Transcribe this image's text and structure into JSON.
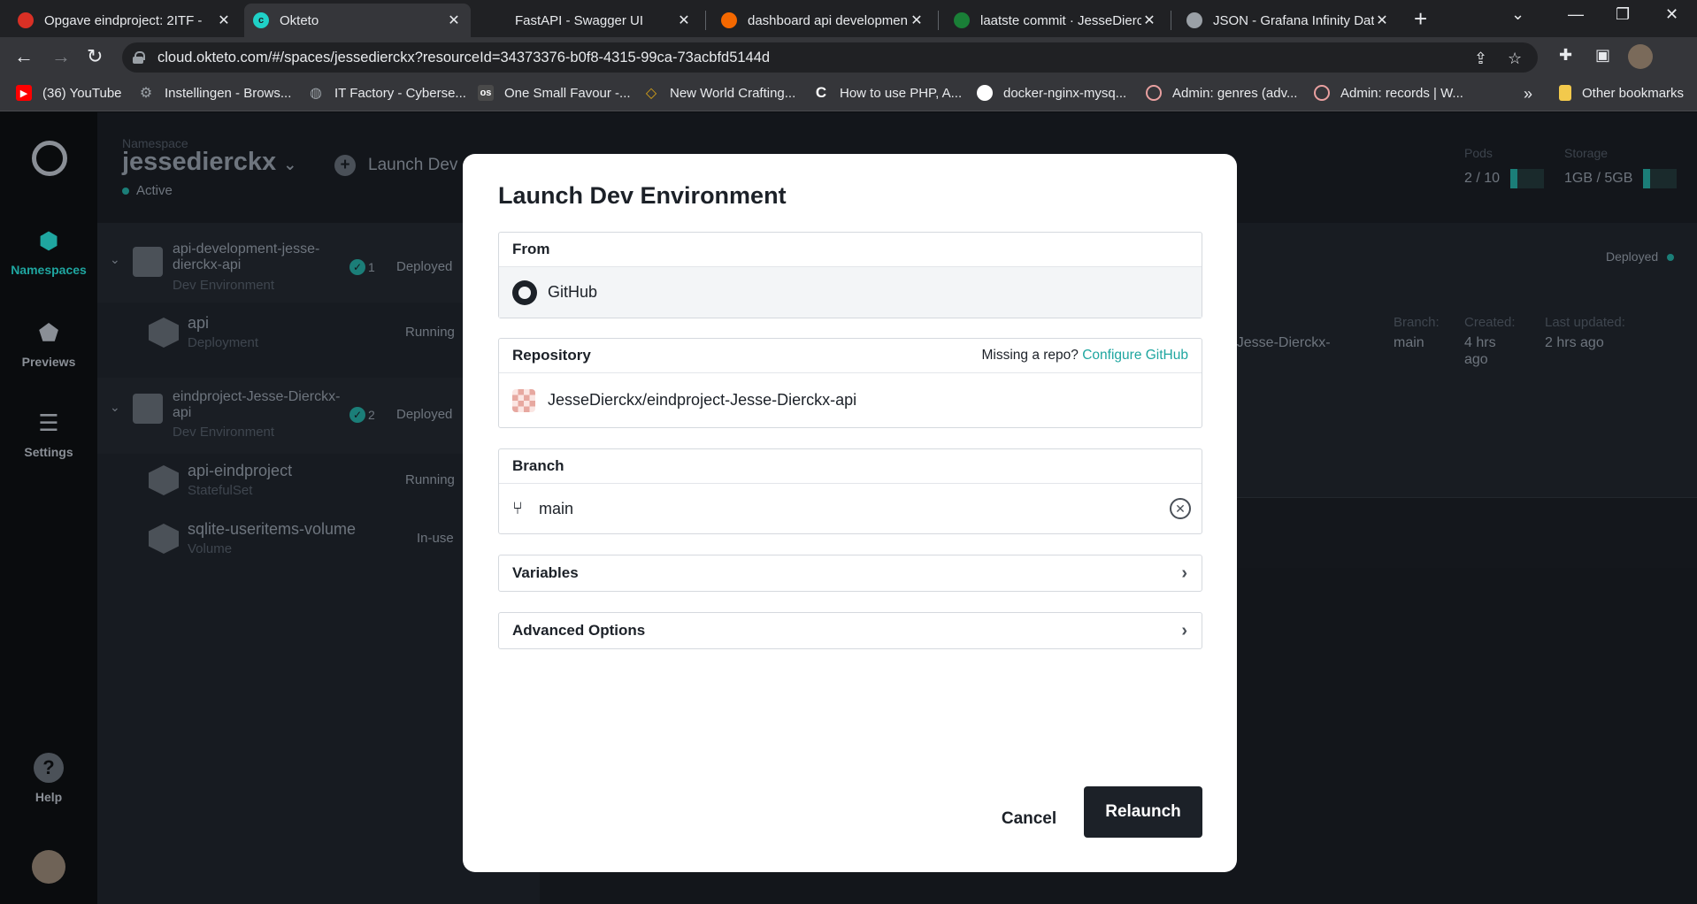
{
  "browser": {
    "tabs": [
      {
        "title": "Opgave eindproject: 2ITF - ",
        "favicon_color": "#d93025",
        "active": false
      },
      {
        "title": "Okteto",
        "favicon_color": "#1fd1c7",
        "active": true
      },
      {
        "title": "FastAPI - Swagger UI",
        "favicon_color": "#202124",
        "active": false
      },
      {
        "title": "dashboard api developmen",
        "favicon_color": "#f46800",
        "active": false
      },
      {
        "title": "laatste commit · JesseDierck",
        "favicon_color": "#1a7f37",
        "active": false
      },
      {
        "title": "JSON - Grafana Infinity Data",
        "favicon_color": "#9aa0a6",
        "active": false
      }
    ],
    "url": "cloud.okteto.com/#/spaces/jessedierckx?resourceId=34373376-b0f8-4315-99ca-73acbfd5144d",
    "bookmarks": [
      {
        "label": "(36) YouTube",
        "color": "#ff0000"
      },
      {
        "label": "Instellingen - Brows...",
        "color": "#9aa0a6"
      },
      {
        "label": "IT Factory - Cyberse...",
        "color": "#9aa0a6"
      },
      {
        "label": "One Small Favour -...",
        "color": "#bbbbbb"
      },
      {
        "label": "New World Crafting...",
        "color": "#d4a017"
      },
      {
        "label": "How to use PHP, A...",
        "color": "#ffffff"
      },
      {
        "label": "docker-nginx-mysq...",
        "color": "#ffffff"
      },
      {
        "label": "Admin: genres (adv...",
        "color": "#e8a0a0"
      },
      {
        "label": "Admin: records | W...",
        "color": "#e8a0a0"
      }
    ],
    "more_bookmarks": "»",
    "other_bookmarks": "Other bookmarks"
  },
  "app": {
    "rail": [
      {
        "label": "Namespaces",
        "icon": "namespaces-icon",
        "active": true
      },
      {
        "label": "Previews",
        "icon": "previews-icon",
        "active": false
      },
      {
        "label": "Settings",
        "icon": "settings-icon",
        "active": false
      },
      {
        "label": "Help",
        "icon": "help-icon",
        "active": false
      }
    ],
    "namespace_label": "Namespace",
    "namespace_name": "jessedierckx",
    "namespace_status": "Active",
    "launch_label": "Launch Dev",
    "pods_label": "Pods",
    "pods_value": "2 / 10",
    "pods_fraction": 0.2,
    "storage_label": "Storage",
    "storage_value": "1GB / 5GB",
    "storage_fraction": 0.2,
    "environments": [
      {
        "name": "api-development-jesse-dierckx-api",
        "type": "Dev Environment",
        "count": "1",
        "status": "Deployed",
        "services": [
          {
            "name": "api",
            "kind": "Deployment",
            "status": "Running"
          }
        ]
      },
      {
        "name": "eindproject-Jesse-Dierckx-api",
        "type": "Dev Environment",
        "count": "2",
        "status": "Deployed",
        "services": [
          {
            "name": "api-eindproject",
            "kind": "StatefulSet",
            "status": "Running"
          },
          {
            "name": "sqlite-useritems-volume",
            "kind": "Volume",
            "status": "In-use"
          }
        ]
      }
    ],
    "detail": {
      "deployed": "Deployed",
      "repo_fragment": "ct-Jesse-Dierckx-",
      "branch_label": "Branch:",
      "branch_value": "main",
      "created_label": "Created:",
      "created_value": "4 hrs ago",
      "updated_label": "Last updated:",
      "updated_value": "2 hrs ago"
    }
  },
  "modal": {
    "title": "Launch Dev Environment",
    "from_label": "From",
    "from_value": "GitHub",
    "repository_label": "Repository",
    "missing_repo": "Missing a repo?",
    "configure_github": "Configure GitHub",
    "repository_value": "JesseDierckx/eindproject-Jesse-Dierckx-api",
    "branch_label": "Branch",
    "branch_value": "main",
    "variables_label": "Variables",
    "advanced_label": "Advanced Options",
    "cancel_label": "Cancel",
    "relaunch_label": "Relaunch"
  }
}
